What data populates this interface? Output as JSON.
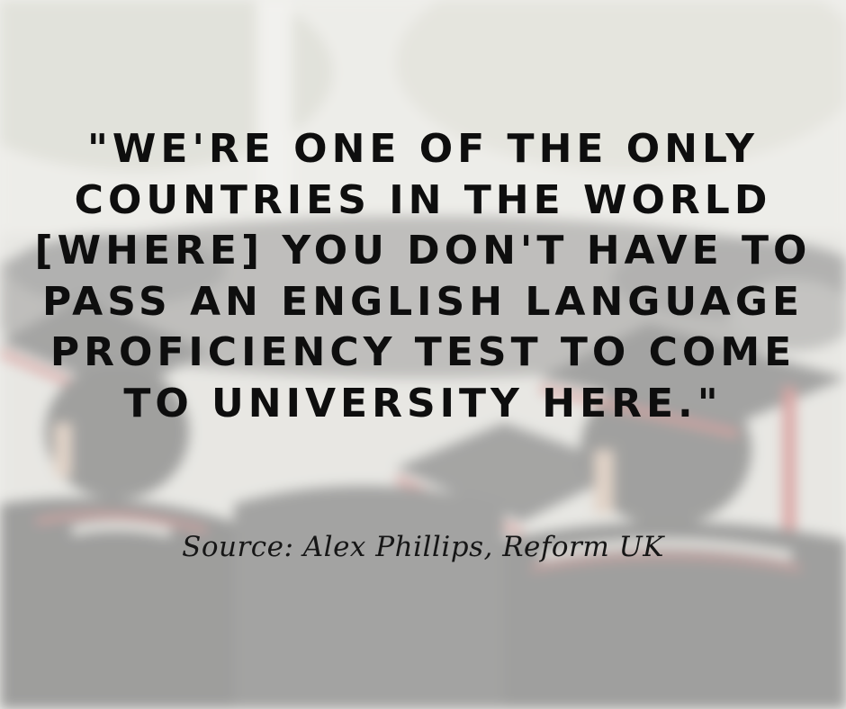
{
  "quote": {
    "lines": [
      "\"WE'RE ONE OF THE ONLY",
      "COUNTRIES IN THE WORLD",
      "[WHERE] YOU DON'T HAVE TO",
      "PASS AN ENGLISH LANGUAGE",
      "PROFICIENCY TEST TO COME",
      "TO UNIVERSITY HERE.\""
    ]
  },
  "source": "Source: Alex Phillips, Reform UK",
  "colors": {
    "text": "#0e0e0e",
    "overlay": "#f0f0ee",
    "gown": "#1c1c1e",
    "accent_red": "#b52a2a"
  },
  "background": {
    "icon": "graduation-crowd-photo"
  }
}
